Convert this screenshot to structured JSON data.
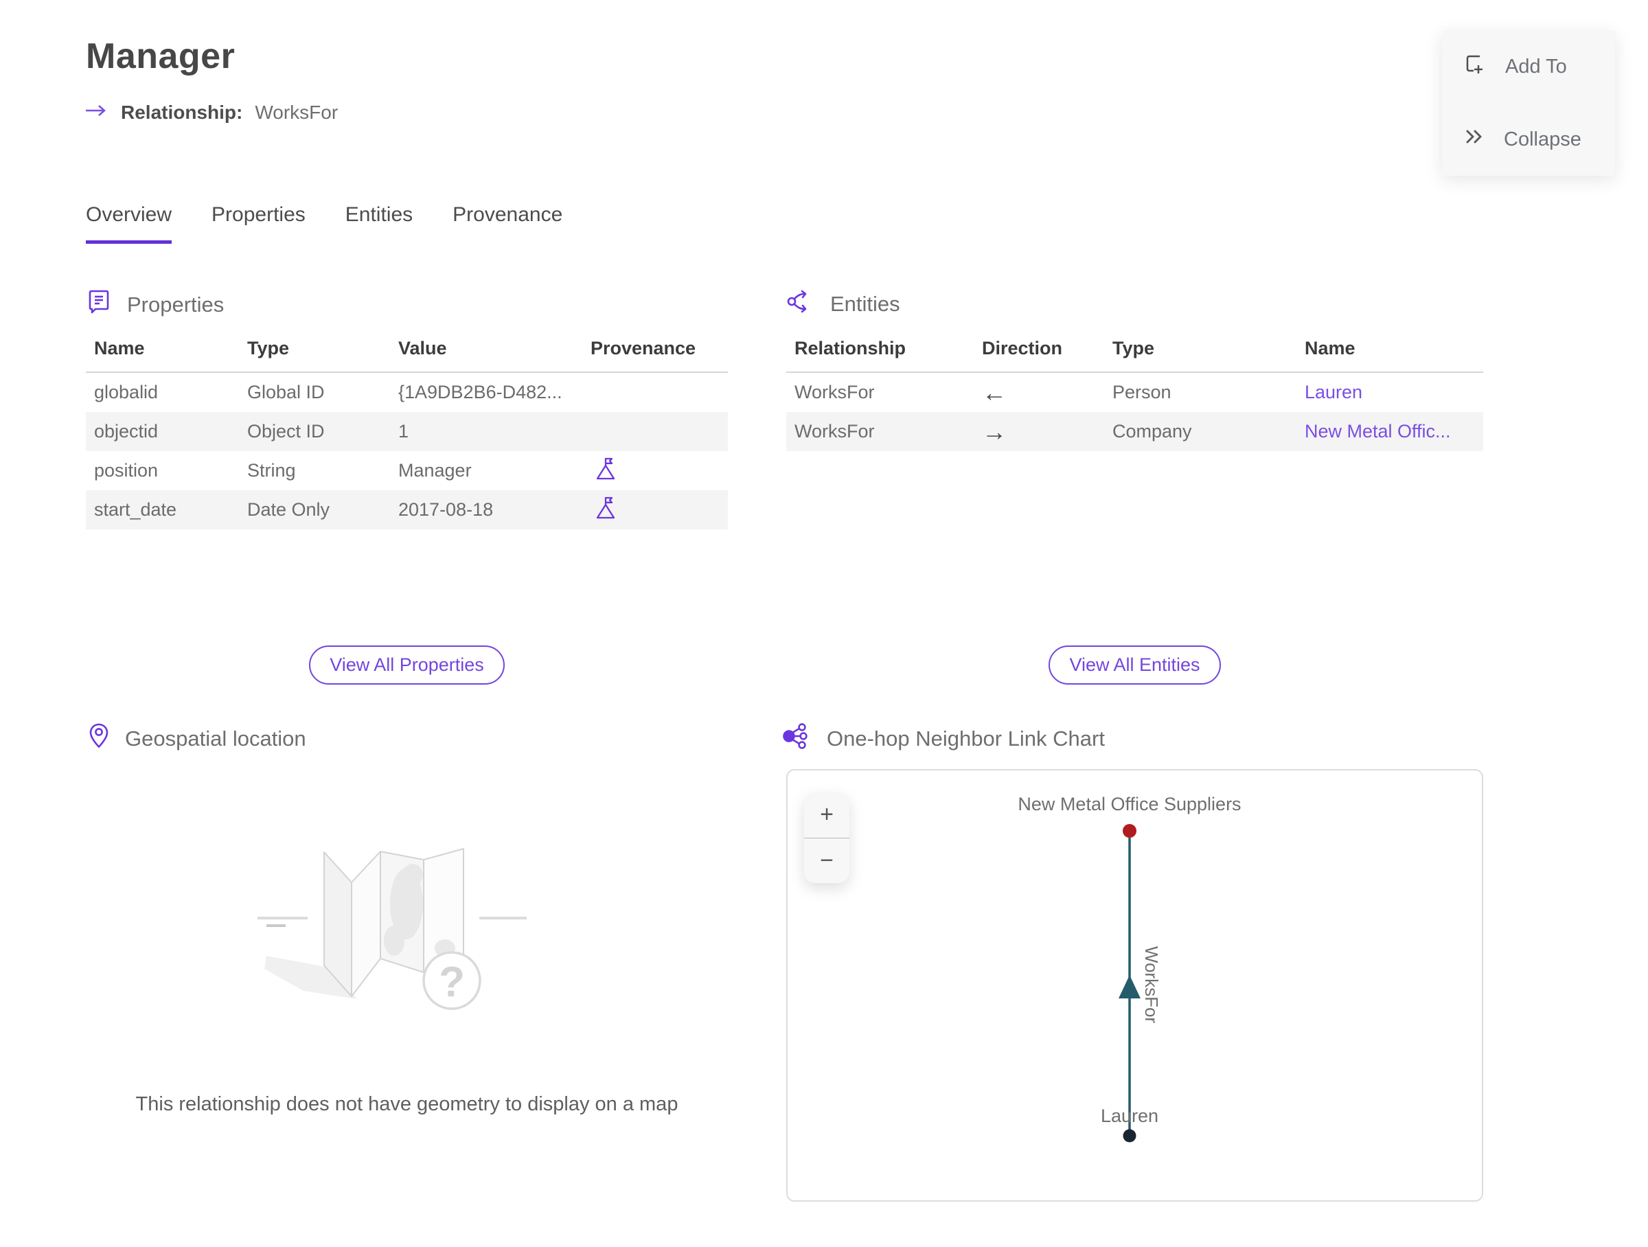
{
  "colors": {
    "accent": "#6a35e0",
    "link": "#7a4fe3"
  },
  "header": {
    "title": "Manager",
    "subtitle_label": "Relationship:",
    "subtitle_value": "WorksFor"
  },
  "actions": {
    "add_to": "Add To",
    "collapse": "Collapse"
  },
  "tabs": [
    {
      "label": "Overview",
      "active": true
    },
    {
      "label": "Properties",
      "active": false
    },
    {
      "label": "Entities",
      "active": false
    },
    {
      "label": "Provenance",
      "active": false
    }
  ],
  "properties_section": {
    "title": "Properties",
    "columns": [
      "Name",
      "Type",
      "Value",
      "Provenance"
    ],
    "rows": [
      {
        "name": "globalid",
        "type": "Global ID",
        "value": "{1A9DB2B6-D482...",
        "provenance": false
      },
      {
        "name": "objectid",
        "type": "Object ID",
        "value": "1",
        "provenance": false
      },
      {
        "name": "position",
        "type": "String",
        "value": "Manager",
        "provenance": true
      },
      {
        "name": "start_date",
        "type": "Date Only",
        "value": "2017-08-18",
        "provenance": true
      }
    ],
    "view_all": "View All Properties"
  },
  "entities_section": {
    "title": "Entities",
    "columns": [
      "Relationship",
      "Direction",
      "Type",
      "Name"
    ],
    "rows": [
      {
        "relationship": "WorksFor",
        "direction": "←",
        "type": "Person",
        "name": "Lauren"
      },
      {
        "relationship": "WorksFor",
        "direction": "→",
        "type": "Company",
        "name": "New Metal Offic..."
      }
    ],
    "view_all": "View All Entities"
  },
  "geospatial_section": {
    "title": "Geospatial location",
    "empty_message": "This relationship does not have geometry to display on a map"
  },
  "link_chart_section": {
    "title": "One-hop Neighbor Link Chart",
    "zoom_in": "+",
    "zoom_out": "−",
    "edge_label": "WorksFor",
    "edge_color": "#255c6b",
    "top_node": {
      "label": "New Metal Office Suppliers",
      "type": "Company",
      "color": "#b11c1f"
    },
    "bottom_node": {
      "label": "Lauren",
      "type": "Person",
      "color": "#1b2531"
    }
  }
}
